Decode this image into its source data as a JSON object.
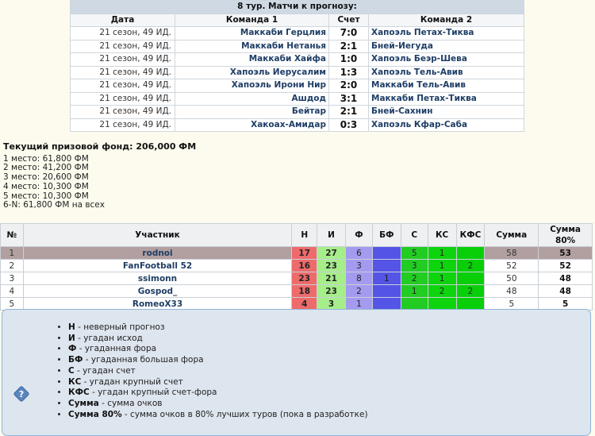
{
  "matches": {
    "caption": "8 тур. Матчи к прогнозу:",
    "headers": [
      "Дата",
      "Команда 1",
      "Счет",
      "Команда 2"
    ],
    "rows": [
      {
        "date": "21 сезон, 49 ИД.",
        "team1": "Маккаби Герцлия",
        "score": "7:0",
        "team2": "Хапоэль Петах-Тиква"
      },
      {
        "date": "21 сезон, 49 ИД.",
        "team1": "Маккаби Нетанья",
        "score": "2:1",
        "team2": "Бней-Иегуда"
      },
      {
        "date": "21 сезон, 49 ИД.",
        "team1": "Маккаби Хайфа",
        "score": "1:0",
        "team2": "Хапоэль Беэр-Шева"
      },
      {
        "date": "21 сезон, 49 ИД.",
        "team1": "Хапоэль Иерусалим",
        "score": "1:3",
        "team2": "Хапоэль Тель-Авив"
      },
      {
        "date": "21 сезон, 49 ИД.",
        "team1": "Хапоэль Ирони Нир",
        "score": "2:0",
        "team2": "Маккаби Тель-Авив"
      },
      {
        "date": "21 сезон, 49 ИД.",
        "team1": "Ашдод",
        "score": "3:1",
        "team2": "Маккаби Петах-Тиква"
      },
      {
        "date": "21 сезон, 49 ИД.",
        "team1": "Бейтар",
        "score": "2:1",
        "team2": "Бней-Сахнин"
      },
      {
        "date": "21 сезон, 49 ИД.",
        "team1": "Хакоах-Амидар",
        "score": "0:3",
        "team2": "Хапоэль Кфар-Саба"
      }
    ]
  },
  "prize": {
    "title": "Текущий призовой фонд: 206,000 ФМ",
    "lines": [
      "1 место: 61,800 ФМ",
      "2 место: 41,200 ФМ",
      "3 место: 20,600 ФМ",
      "4 место: 10,300 ФМ",
      "5 место: 10,300 ФМ",
      "6-N: 61,800 ФМ на всех"
    ]
  },
  "standings": {
    "headers": [
      "№",
      "Участник",
      "Н",
      "И",
      "Ф",
      "БФ",
      "С",
      "КС",
      "КФС",
      "Сумма",
      "Сумма 80%"
    ],
    "rows": [
      {
        "n": "1",
        "name": "rodnoi",
        "H": "17",
        "I": "27",
        "F": "6",
        "BF": "",
        "S": "5",
        "KS": "1",
        "KFS": "",
        "sum": "58",
        "sum80": "53"
      },
      {
        "n": "2",
        "name": "FanFootball 52",
        "H": "16",
        "I": "23",
        "F": "3",
        "BF": "",
        "S": "3",
        "KS": "1",
        "KFS": "2",
        "sum": "52",
        "sum80": "52"
      },
      {
        "n": "3",
        "name": "ssimonn",
        "H": "23",
        "I": "21",
        "F": "8",
        "BF": "1",
        "S": "2",
        "KS": "1",
        "KFS": "",
        "sum": "50",
        "sum80": "48"
      },
      {
        "n": "4",
        "name": "Gospod_",
        "H": "18",
        "I": "23",
        "F": "2",
        "BF": "",
        "S": "1",
        "KS": "2",
        "KFS": "2",
        "sum": "48",
        "sum80": "48"
      },
      {
        "n": "5",
        "name": "RomeoX33",
        "H": "4",
        "I": "3",
        "F": "1",
        "BF": "",
        "S": "",
        "KS": "",
        "KFS": "",
        "sum": "5",
        "sum80": "5"
      }
    ]
  },
  "legend": {
    "icon": "help-question-icon",
    "items": [
      {
        "term": "Н",
        "desc": " - неверный прогноз"
      },
      {
        "term": "И",
        "desc": " - угадан исход"
      },
      {
        "term": "Ф",
        "desc": " - угаданная фора"
      },
      {
        "term": "БФ",
        "desc": " - угаданная большая фора"
      },
      {
        "term": "С",
        "desc": " - угадан счет"
      },
      {
        "term": "КС",
        "desc": " - угадан крупный счет"
      },
      {
        "term": "КФС",
        "desc": " - угадан крупный счет-фора"
      },
      {
        "term": "Сумма",
        "desc": " - сумма очков"
      },
      {
        "term": "Сумма 80%",
        "desc": " - сумма очков в 80% лучших туров (пока в разработке)"
      }
    ]
  },
  "colors": {
    "H": "#ee6b6b",
    "I": "#a6ee8a",
    "F": "#a49bf0",
    "BF": "#5454e6",
    "S": "#22cc22",
    "KS": "#0ed40e",
    "KFS": "#09cf09",
    "highlight": "#b29f9f"
  }
}
